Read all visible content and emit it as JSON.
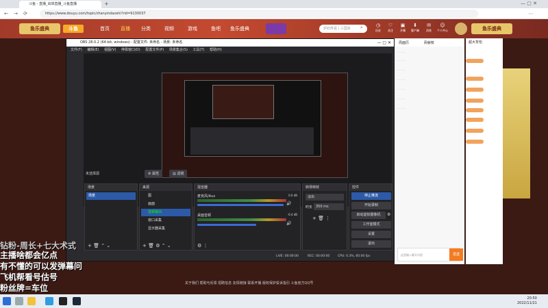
{
  "browser": {
    "tab1": "斗鱼 - 直播_出体直播_斗鱼直播",
    "url": "https://www.douyu.com/topic/zhanyindaoshi?rid=9130037"
  },
  "site": {
    "nav": [
      "首页",
      "直播",
      "分类",
      "视频",
      "游戏",
      "鱼吧",
      "鱼乐盛典"
    ],
    "search_placeholder": "炉石传说 | 三国杀",
    "header_icons": [
      "历史",
      "关注",
      "开播",
      "客户端",
      "消息",
      "个人中心"
    ],
    "promo_logo": "鱼乐盛典"
  },
  "obs": {
    "title": "OBS 28.0.2 (64-bit, windows) - 配置文件: 未命名 - 场景: 未命名",
    "menu": [
      "文件(F)",
      "编辑(E)",
      "视图(V)",
      "停靠窗口(D)",
      "配置文件(P)",
      "场景集合(S)",
      "工具(T)",
      "帮助(H)"
    ],
    "no_source": "未选择源",
    "btn_props": "属性",
    "btn_filters": "滤镜",
    "docks": {
      "scenes": "场景",
      "sources": "来源",
      "mixer": "混音器",
      "transitions": "转场特效",
      "controls": "控件"
    },
    "scene_item": "场景",
    "sources_list": [
      "图",
      "画面",
      "音频输出",
      "窗口采集",
      "显示器采集"
    ],
    "mixer": [
      {
        "label": "麦克风/Aux",
        "db": "0.0 dB"
      },
      {
        "label": "桌面音频",
        "db": "-0.4 dB"
      }
    ],
    "transition": {
      "type": "淡出",
      "duration_label": "时长",
      "duration": "350 ms"
    },
    "controls": [
      "停止推流",
      "开始录制",
      "启动虚拟摄像机",
      "工作室模式",
      "设置",
      "退出"
    ],
    "status": {
      "live": "LIVE: 00:00:00",
      "rec": "REC: 00:00:00",
      "cpu": "CPU: 0.3%, 60.00 fps"
    }
  },
  "overlay_lines": [
    "主播啥都会亿点",
    "有不懂的可以发弹幕问",
    "飞机帮看号估号",
    "粉丝牌=车位"
  ],
  "danmaku_top": "钻粉-周长+七大术式",
  "footer_links": "关于我们  帮助与反馈  招聘信息  友情链接  联系开播  版权保护投诉指引  斗鱼官方QQ号",
  "room": {
    "tabs": [
      "周面历",
      "贡献榜"
    ],
    "tab_right": "超大背包",
    "chat_input": "这里输入聊天内容",
    "send": "发送"
  },
  "clock": {
    "time": "20:50",
    "date": "2022/11/21"
  }
}
